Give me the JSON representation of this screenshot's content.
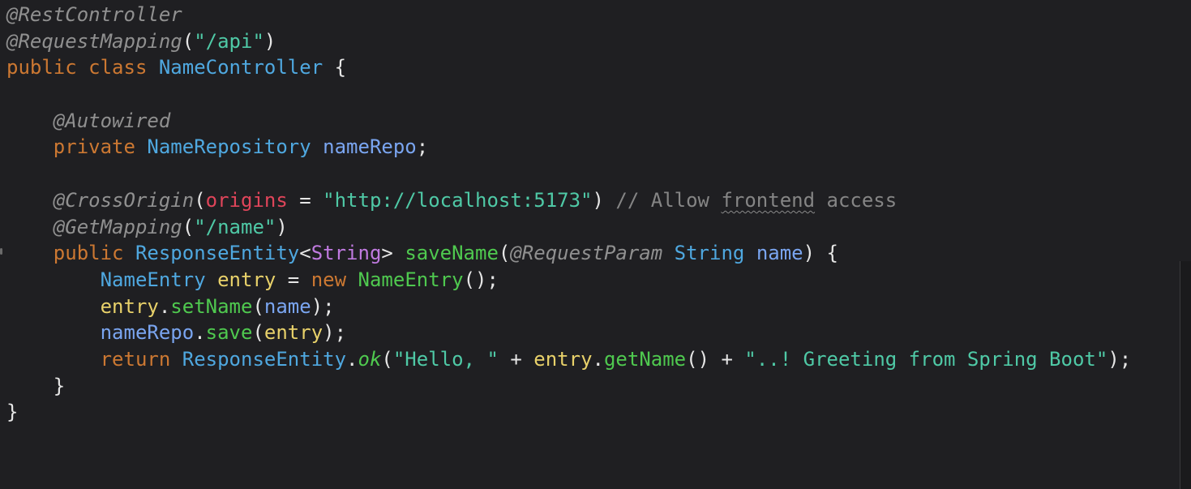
{
  "editor": {
    "lines": [
      [
        {
          "t": "@RestController",
          "c": "ann"
        }
      ],
      [
        {
          "t": "@RequestMapping",
          "c": "ann"
        },
        {
          "t": "(",
          "c": "punc"
        },
        {
          "t": "\"/api\"",
          "c": "str"
        },
        {
          "t": ")",
          "c": "punc"
        }
      ],
      [
        {
          "t": "public",
          "c": "kw"
        },
        {
          "t": " "
        },
        {
          "t": "class",
          "c": "kw"
        },
        {
          "t": " "
        },
        {
          "t": "NameController",
          "c": "cls"
        },
        {
          "t": " {",
          "c": "punc"
        }
      ],
      [],
      [
        {
          "t": "    "
        },
        {
          "t": "@Autowired",
          "c": "ann"
        }
      ],
      [
        {
          "t": "    "
        },
        {
          "t": "private",
          "c": "kw"
        },
        {
          "t": " "
        },
        {
          "t": "NameRepository",
          "c": "cls"
        },
        {
          "t": " "
        },
        {
          "t": "nameRepo",
          "c": "param"
        },
        {
          "t": ";",
          "c": "punc"
        }
      ],
      [],
      [
        {
          "t": "    "
        },
        {
          "t": "@CrossOrigin",
          "c": "ann"
        },
        {
          "t": "(",
          "c": "punc"
        },
        {
          "t": "origins",
          "c": "prop"
        },
        {
          "t": " = ",
          "c": "punc"
        },
        {
          "t": "\"http://localhost:5173\"",
          "c": "str"
        },
        {
          "t": ") ",
          "c": "punc"
        },
        {
          "t": "// Allow ",
          "c": "cmt"
        },
        {
          "t": "frontend",
          "c": "cmt squiggle"
        },
        {
          "t": " access",
          "c": "cmt"
        }
      ],
      [
        {
          "t": "    "
        },
        {
          "t": "@GetMapping",
          "c": "ann"
        },
        {
          "t": "(",
          "c": "punc"
        },
        {
          "t": "\"/name\"",
          "c": "str"
        },
        {
          "t": ")",
          "c": "punc"
        }
      ],
      [
        {
          "t": "    "
        },
        {
          "t": "public",
          "c": "kw"
        },
        {
          "t": " "
        },
        {
          "t": "ResponseEntity",
          "c": "cls"
        },
        {
          "t": "<",
          "c": "punc"
        },
        {
          "t": "String",
          "c": "gen"
        },
        {
          "t": "> ",
          "c": "punc"
        },
        {
          "t": "saveName",
          "c": "method"
        },
        {
          "t": "(",
          "c": "punc"
        },
        {
          "t": "@RequestParam",
          "c": "ann"
        },
        {
          "t": " "
        },
        {
          "t": "String",
          "c": "cls"
        },
        {
          "t": " "
        },
        {
          "t": "name",
          "c": "param"
        },
        {
          "t": ") {",
          "c": "punc"
        }
      ],
      [
        {
          "t": "        "
        },
        {
          "t": "NameEntry",
          "c": "cls"
        },
        {
          "t": " "
        },
        {
          "t": "entry",
          "c": "var"
        },
        {
          "t": " = ",
          "c": "punc"
        },
        {
          "t": "new",
          "c": "kw"
        },
        {
          "t": " "
        },
        {
          "t": "NameEntry",
          "c": "method"
        },
        {
          "t": "();",
          "c": "punc"
        }
      ],
      [
        {
          "t": "        "
        },
        {
          "t": "entry",
          "c": "var"
        },
        {
          "t": ".",
          "c": "punc"
        },
        {
          "t": "setName",
          "c": "method"
        },
        {
          "t": "(",
          "c": "punc"
        },
        {
          "t": "name",
          "c": "param"
        },
        {
          "t": ");",
          "c": "punc"
        }
      ],
      [
        {
          "t": "        "
        },
        {
          "t": "nameRepo",
          "c": "param"
        },
        {
          "t": ".",
          "c": "punc"
        },
        {
          "t": "save",
          "c": "method"
        },
        {
          "t": "(",
          "c": "punc"
        },
        {
          "t": "entry",
          "c": "var"
        },
        {
          "t": ");",
          "c": "punc"
        }
      ],
      [
        {
          "t": "        "
        },
        {
          "t": "return",
          "c": "ret"
        },
        {
          "t": " "
        },
        {
          "t": "ResponseEntity",
          "c": "cls"
        },
        {
          "t": ".",
          "c": "punc"
        },
        {
          "t": "ok",
          "c": "static"
        },
        {
          "t": "(",
          "c": "punc"
        },
        {
          "t": "\"Hello, \"",
          "c": "str"
        },
        {
          "t": " + ",
          "c": "punc"
        },
        {
          "t": "entry",
          "c": "var"
        },
        {
          "t": ".",
          "c": "punc"
        },
        {
          "t": "getName",
          "c": "method"
        },
        {
          "t": "() + ",
          "c": "punc"
        },
        {
          "t": "\"..! Greeting from Spring Boot\"",
          "c": "str"
        },
        {
          "t": ");",
          "c": "punc"
        }
      ],
      [
        {
          "t": "    "
        },
        {
          "t": "}",
          "c": "punc"
        }
      ],
      [
        {
          "t": "}",
          "c": "punc"
        }
      ]
    ],
    "current_line_index": 13
  },
  "colors": {
    "background": "#1f1f22",
    "current_line": "#2e2e30"
  }
}
